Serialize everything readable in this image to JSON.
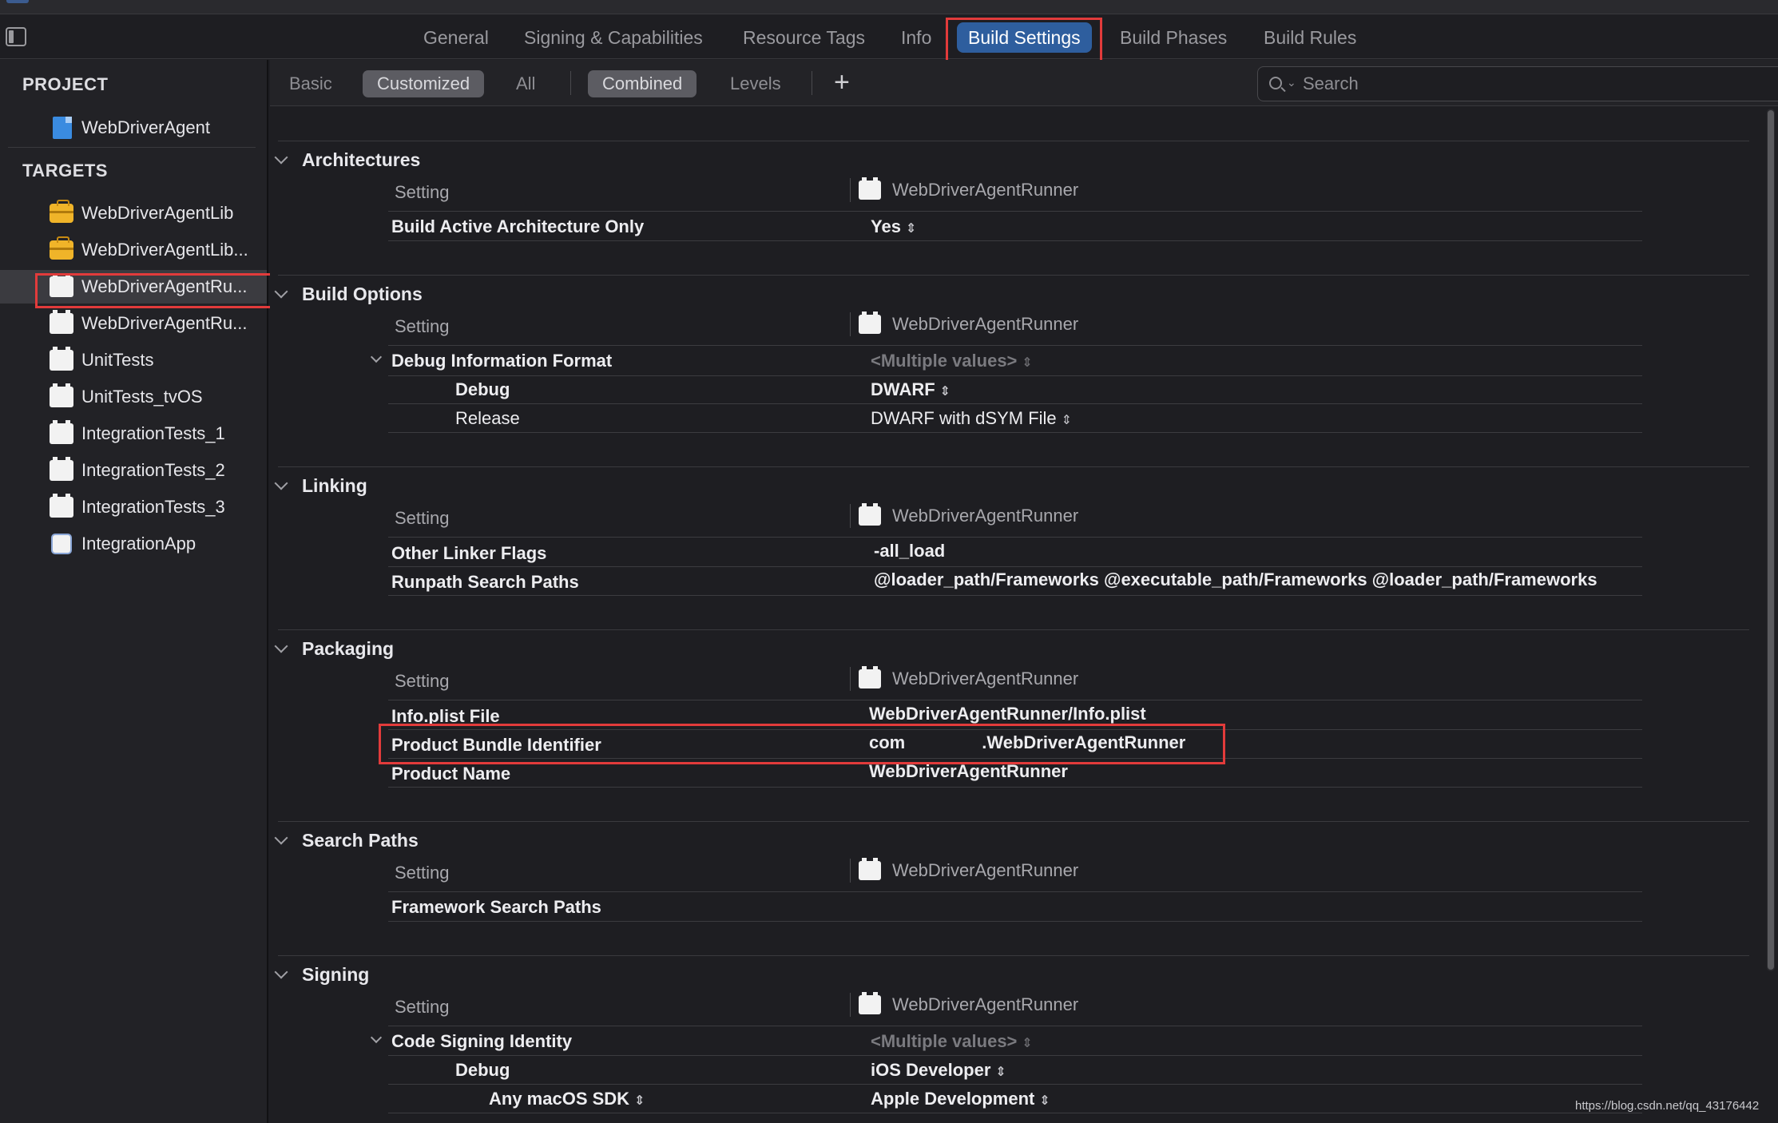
{
  "tabs": [
    "General",
    "Signing & Capabilities",
    "Resource Tags",
    "Info",
    "Build Settings",
    "Build Phases",
    "Build Rules"
  ],
  "sidebar": {
    "project_header": "PROJECT",
    "project": "WebDriverAgent",
    "targets_header": "TARGETS",
    "targets": [
      {
        "label": "WebDriverAgentLib",
        "icon": "framework-icon"
      },
      {
        "label": "WebDriverAgentLib...",
        "icon": "framework-icon"
      },
      {
        "label": "WebDriverAgentRu...",
        "icon": "target-icon"
      },
      {
        "label": "WebDriverAgentRu...",
        "icon": "target-icon"
      },
      {
        "label": "UnitTests",
        "icon": "target-icon"
      },
      {
        "label": "UnitTests_tvOS",
        "icon": "target-icon"
      },
      {
        "label": "IntegrationTests_1",
        "icon": "target-icon"
      },
      {
        "label": "IntegrationTests_2",
        "icon": "target-icon"
      },
      {
        "label": "IntegrationTests_3",
        "icon": "target-icon"
      },
      {
        "label": "IntegrationApp",
        "icon": "app-icon"
      }
    ]
  },
  "filter": {
    "basic": "Basic",
    "customized": "Customized",
    "all": "All",
    "combined": "Combined",
    "levels": "Levels",
    "add": "+",
    "search_placeholder": "Search"
  },
  "setting_header": "Setting",
  "target_header": "WebDriverAgentRunner",
  "sections": {
    "architectures": {
      "title": "Architectures",
      "rows": [
        {
          "name": "Build Active Architecture Only",
          "value": "Yes"
        }
      ]
    },
    "build_options": {
      "title": "Build Options",
      "rows": [
        {
          "name": "Debug Information Format",
          "value": "<Multiple values>"
        },
        {
          "name": "Debug",
          "value": "DWARF"
        },
        {
          "name": "Release",
          "value": "DWARF with dSYM File"
        }
      ]
    },
    "linking": {
      "title": "Linking",
      "rows": [
        {
          "name": "Other Linker Flags",
          "value": "-all_load"
        },
        {
          "name": "Runpath Search Paths",
          "value": "@loader_path/Frameworks @executable_path/Frameworks @loader_path/Frameworks"
        }
      ]
    },
    "packaging": {
      "title": "Packaging",
      "rows": [
        {
          "name": "Info.plist File",
          "value": "WebDriverAgentRunner/Info.plist"
        },
        {
          "name": "Product Bundle Identifier",
          "value_prefix": "com",
          "value_suffix": ".WebDriverAgentRunner"
        },
        {
          "name": "Product Name",
          "value": "WebDriverAgentRunner"
        }
      ]
    },
    "search_paths": {
      "title": "Search Paths",
      "rows": [
        {
          "name": "Framework Search Paths",
          "value": ""
        }
      ]
    },
    "signing": {
      "title": "Signing",
      "rows": [
        {
          "name": "Code Signing Identity",
          "value": "<Multiple values>"
        },
        {
          "name": "Debug",
          "value": "iOS Developer"
        },
        {
          "name": "Any macOS SDK",
          "value": "Apple Development"
        }
      ]
    }
  },
  "watermark": "https://blog.csdn.net/qq_43176442",
  "colors": {
    "accent": "#2e5e9e",
    "highlight": "#e23b3b"
  }
}
